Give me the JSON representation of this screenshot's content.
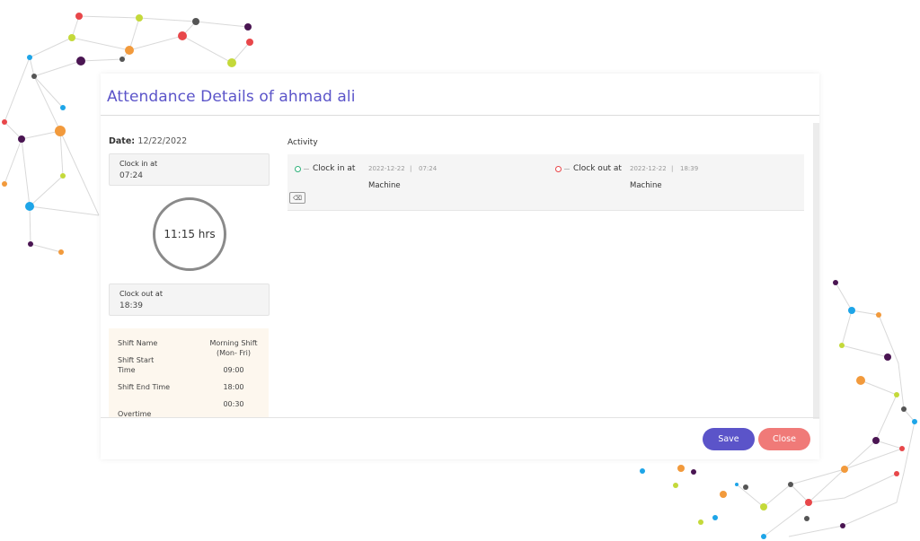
{
  "modal": {
    "title": "Attendance Details of ahmad ali"
  },
  "summary": {
    "date_label": "Date:",
    "date_value": "12/22/2022",
    "clock_in": {
      "label": "Clock in at",
      "value": "07:24"
    },
    "total_hours": "11:15 hrs",
    "clock_out": {
      "label": "Clock out at",
      "value": "18:39"
    }
  },
  "shift": {
    "name_label": "Shift Name",
    "name_value": "Morning Shift (Mon- Fri)",
    "start_label": "Shift Start Time",
    "start_value": "09:00",
    "end_label": "Shift End Time",
    "end_value": "18:00",
    "overtime_label": "Overtime",
    "overtime_value": "00:30"
  },
  "activity": {
    "heading": "Activity",
    "items": [
      {
        "title": "Clock in at",
        "date": "2022-12-22",
        "sep": "|",
        "time": "07:24",
        "source": "Machine",
        "dot_color": "#2fb27a"
      },
      {
        "title": "Clock out at",
        "date": "2022-12-22",
        "sep": "|",
        "time": "18:39",
        "source": "Machine",
        "dot_color": "#e8474a"
      }
    ]
  },
  "buttons": {
    "save": "Save",
    "close": "Close"
  },
  "colors": {
    "accent": "#5b54c9",
    "close": "#f07a78",
    "shift_panel": "#fdf7ee"
  }
}
